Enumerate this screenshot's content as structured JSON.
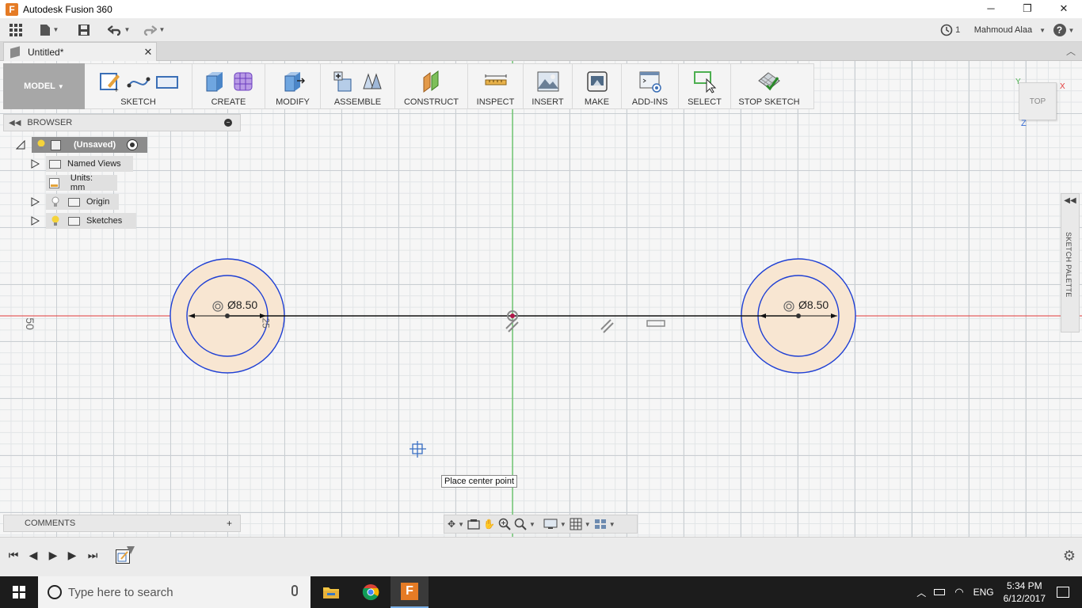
{
  "window": {
    "title": "Autodesk Fusion 360",
    "minimize": "─",
    "maximize": "❐",
    "close": "✕"
  },
  "qat": {
    "job_count": "1",
    "user": "Mahmoud Alaa",
    "help": "?"
  },
  "document": {
    "tab_title": "Untitled*",
    "close": "✕",
    "collapse": "︿"
  },
  "toolbar": {
    "workspace": "MODEL",
    "groups": [
      "SKETCH",
      "CREATE",
      "MODIFY",
      "ASSEMBLE",
      "CONSTRUCT",
      "INSPECT",
      "INSERT",
      "MAKE",
      "ADD-INS",
      "SELECT",
      "STOP SKETCH"
    ]
  },
  "browser": {
    "title": "BROWSER",
    "root": "(Unsaved)",
    "items": [
      {
        "label": "Named Views"
      },
      {
        "label": "Units: mm"
      },
      {
        "label": "Origin"
      },
      {
        "label": "Sketches"
      }
    ]
  },
  "sketch": {
    "dimensions": [
      "Ø8.50",
      "Ø8.50"
    ],
    "ruler_left": "50",
    "ruler_mid": "25"
  },
  "tooltip": "Place center point",
  "comments": {
    "title": "COMMENTS"
  },
  "viewcube": {
    "face": "TOP",
    "axis_x": "X",
    "axis_y": "Y",
    "axis_z": "Z"
  },
  "sketch_palette": {
    "label": "SKETCH PALETTE"
  },
  "taskbar": {
    "search_placeholder": "Type here to search",
    "language": "ENG",
    "time": "5:34 PM",
    "date": "6/12/2017"
  },
  "colors": {
    "sketch_blue": "#1e3fd4",
    "axis_red": "#e23a3a",
    "axis_green": "#3fbf3f",
    "profile_fill": "#f8e6d2",
    "workspace_bg": "#a7a7a7"
  }
}
